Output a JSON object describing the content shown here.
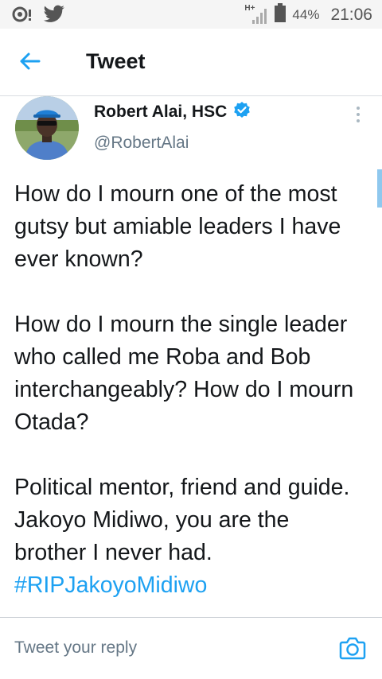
{
  "statusbar": {
    "network": "H+",
    "battery": "44%",
    "time": "21:06",
    "icons": [
      "notification-icon",
      "twitter-bird-icon",
      "signal-icon",
      "battery-icon"
    ]
  },
  "appbar": {
    "title": "Tweet",
    "back_icon": "arrow-left-icon"
  },
  "tweet": {
    "author": {
      "display_name": "Robert Alai, HSC",
      "handle": "@RobertAlai",
      "verified": true
    },
    "paragraphs": [
      "How do I mourn one of the most gutsy but amiable leaders I have ever known?",
      "How do I mourn the single leader who called me Roba and Bob interchangeably? How do I mourn Otada?",
      "Political mentor, friend and guide. Jakoyo Midiwo, you are the brother I never had."
    ],
    "hashtag": "#RIPJakoyoMidiwo"
  },
  "reply": {
    "placeholder": "Tweet your reply",
    "camera_icon": "camera-icon"
  },
  "colors": {
    "accent": "#1da1f2",
    "text": "#14171a",
    "secondary_text": "#657786"
  }
}
